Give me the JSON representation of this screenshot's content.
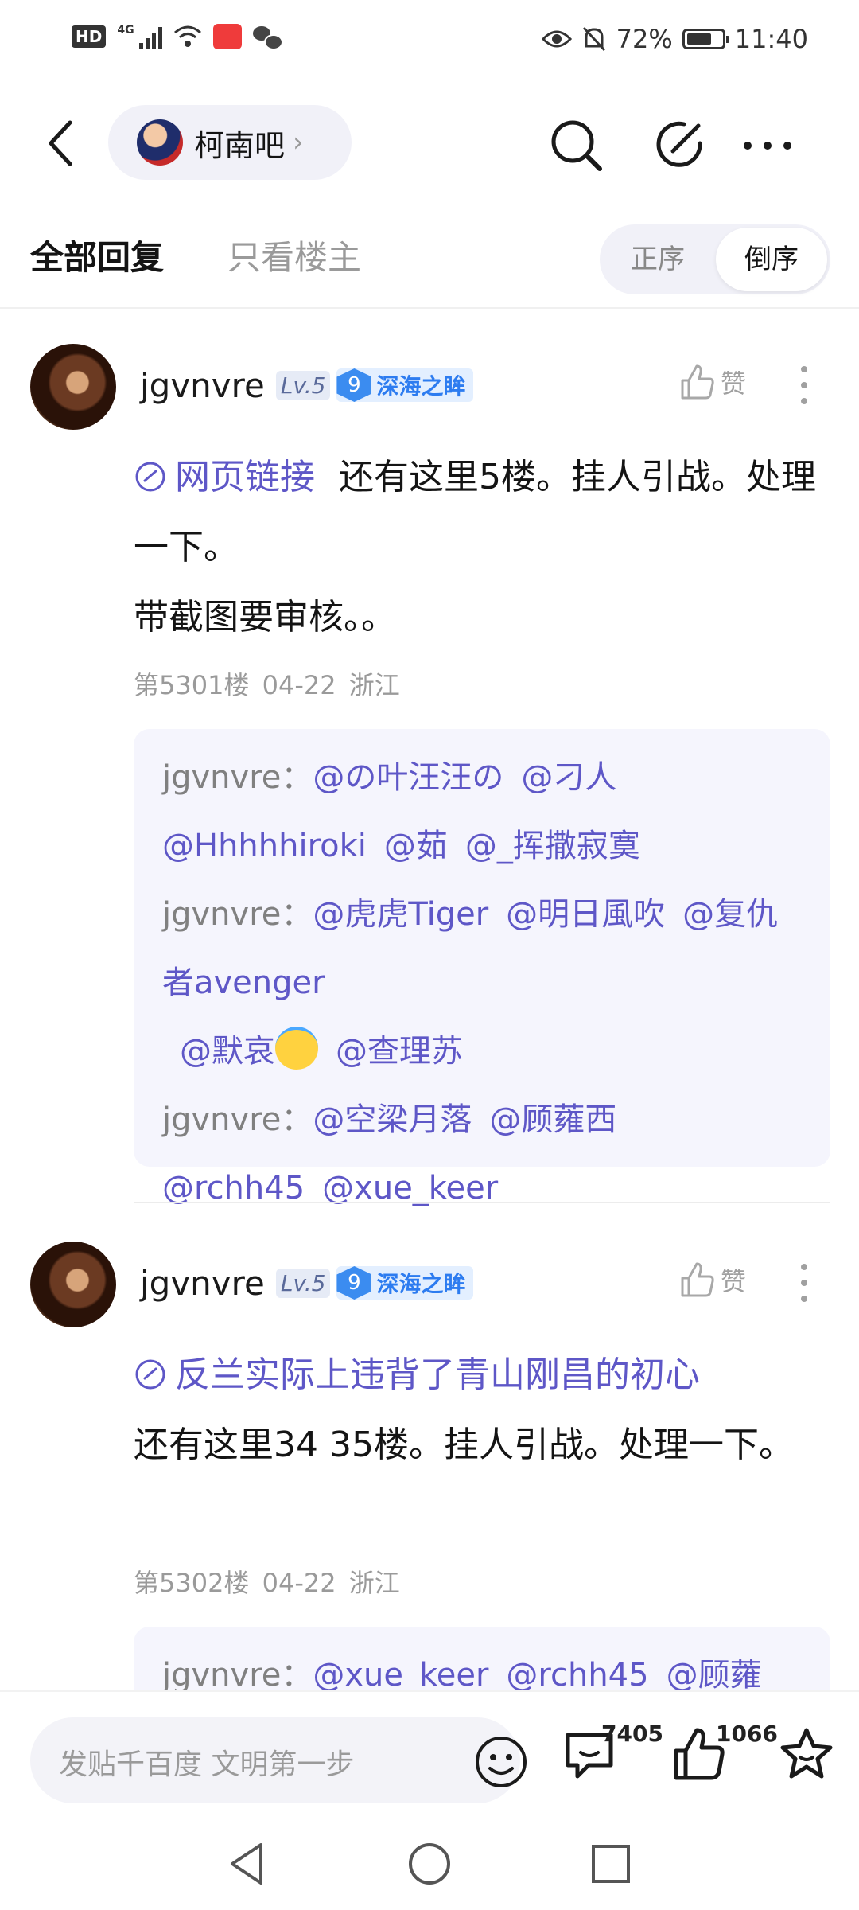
{
  "status_bar": {
    "hd": "HD",
    "network": "4G",
    "battery": "72%",
    "battery_level": 0.72,
    "time": "11:40"
  },
  "header": {
    "forum_name": "柯南吧",
    "icons": [
      "back-icon",
      "search-icon",
      "edit-icon",
      "more-icon"
    ]
  },
  "tabs": {
    "all_replies": "全部回复",
    "op_only": "只看楼主",
    "sort_asc": "正序",
    "sort_desc": "倒序",
    "active_sort": "倒序"
  },
  "posts": [
    {
      "username": "jgvnvre",
      "level": "Lv.5",
      "medal_level": "9",
      "medal_name": "深海之眸",
      "like_label": "赞",
      "link_text": "网页链接",
      "text_after_link": "还有这里5楼。挂人引战。处理一下。",
      "text_line2": "带截图要审核。。",
      "meta": "第5301楼  04-22  浙江",
      "sub_replies": [
        {
          "user": "jgvnvre：",
          "mentions": [
            "@の叶汪汪の",
            "@刁人",
            "@Hhhhhiroki",
            "@茹",
            "@_挥撒寂寞"
          ]
        },
        {
          "user": "jgvnvre：",
          "mentions": [
            "@虎虎Tiger",
            "@明日風吹",
            "@复仇者avenger",
            "@默哀",
            "@查理苏"
          ]
        },
        {
          "user": "jgvnvre：",
          "mentions": [
            "@空梁月落",
            "@顾蕹西",
            "@rchh45",
            "@xue_keer"
          ]
        }
      ]
    },
    {
      "username": "jgvnvre",
      "level": "Lv.5",
      "medal_level": "9",
      "medal_name": "深海之眸",
      "like_label": "赞",
      "link_text": "反兰实际上违背了青山刚昌的初心",
      "text_after_link": "还有这里34 35楼。挂人引战。处理一下。",
      "meta": "第5302楼  04-22  浙江",
      "sub_replies": [
        {
          "user": "jgvnvre：",
          "mentions": [
            "@xue_keer",
            "@rchh45",
            "@顾蕹"
          ]
        }
      ]
    }
  ],
  "bottom_bar": {
    "reply_placeholder": "发贴千百度 文明第一步",
    "comment_count": "7405",
    "like_count": "1066"
  },
  "colors": {
    "link": "#5e57c7",
    "medal": "#3b8cf0",
    "meta": "#9a9a9a"
  }
}
